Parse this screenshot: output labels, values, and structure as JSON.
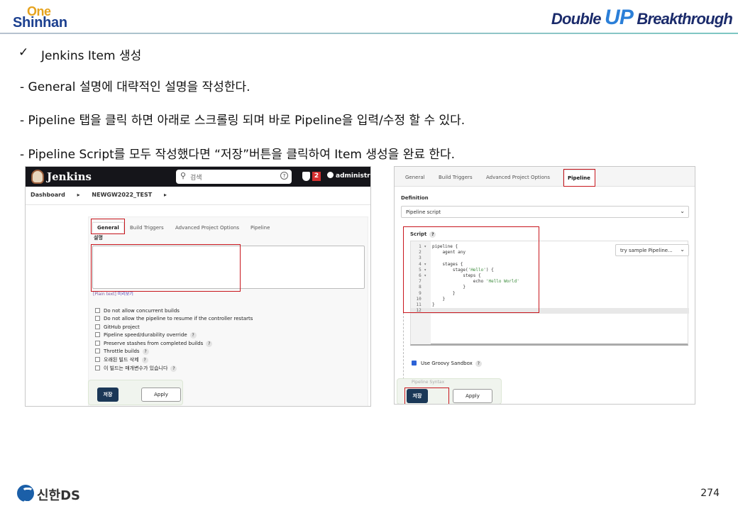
{
  "header": {
    "logo_one": "One",
    "logo_shinhan": "Shinhan",
    "logo_double": "Double",
    "logo_up": "UP",
    "logo_breakthrough": "Breakthrough"
  },
  "slide": {
    "check_mark": "✓",
    "title": "Jenkins Item 생성",
    "bullets": [
      "- General 설명에 대략적인 설명을 작성한다.",
      "- Pipeline 탭을 클릭 하면 아래로 스크롤링 되며 바로 Pipeline을 입력/수정 할 수 있다.",
      "- Pipeline Script를 모두 작성했다면 “저장”버튼을 클릭하여 Item 생성을 완료 한다."
    ]
  },
  "left_shot": {
    "app_title": "Jenkins",
    "search_placeholder": "검색",
    "search_help": "?",
    "badge_count": "2",
    "user": "administrat",
    "breadcrumbs": [
      "Dashboard",
      "▸",
      "NEWGW2022_TEST",
      "▸"
    ],
    "tabs": [
      "General",
      "Build Triggers",
      "Advanced Project Options",
      "Pipeline"
    ],
    "description_label": "설명",
    "plain_text": "[Plain text]",
    "preview": "미리보기",
    "options": [
      {
        "label": "Do not allow concurrent builds",
        "help": false
      },
      {
        "label": "Do not allow the pipeline to resume if the controller restarts",
        "help": false
      },
      {
        "label": "GitHub project",
        "help": false
      },
      {
        "label": "Pipeline speed/durability override",
        "help": true
      },
      {
        "label": "Preserve stashes from completed builds",
        "help": true
      },
      {
        "label": "Throttle builds",
        "help": true
      },
      {
        "label": "오래된 빌드 삭제",
        "help": true
      },
      {
        "label": "이 빌드는 매개변수가 있습니다",
        "help": true
      }
    ],
    "save_label": "저장",
    "apply_label": "Apply"
  },
  "right_shot": {
    "tabs": [
      "General",
      "Build Triggers",
      "Advanced Project Options",
      "Pipeline"
    ],
    "definition_label": "Definition",
    "definition_value": "Pipeline script",
    "script_label": "Script",
    "sample_select": "try sample Pipeline...",
    "code_lines": [
      {
        "n": "1",
        "fold": "▾",
        "text": "pipeline {"
      },
      {
        "n": "2",
        "fold": "",
        "text": "    agent any"
      },
      {
        "n": "3",
        "fold": "",
        "text": ""
      },
      {
        "n": "4",
        "fold": "▾",
        "text": "    stages {"
      },
      {
        "n": "5",
        "fold": "▾",
        "text": "        stage('Hello') {"
      },
      {
        "n": "6",
        "fold": "▾",
        "text": "            steps {"
      },
      {
        "n": "7",
        "fold": "",
        "text": "                echo 'Hello World'"
      },
      {
        "n": "8",
        "fold": "",
        "text": "            }"
      },
      {
        "n": "9",
        "fold": "",
        "text": "        }"
      },
      {
        "n": "10",
        "fold": "",
        "text": "    }"
      },
      {
        "n": "11",
        "fold": "",
        "text": "}"
      },
      {
        "n": "12",
        "fold": "",
        "text": ""
      }
    ],
    "sandbox_label": "Use Groovy Sandbox",
    "pipeline_syntax": "Pipeline Syntax",
    "save_label": "저장",
    "apply_label": "Apply"
  },
  "footer": {
    "brand": "신한DS",
    "page_number": "274"
  }
}
